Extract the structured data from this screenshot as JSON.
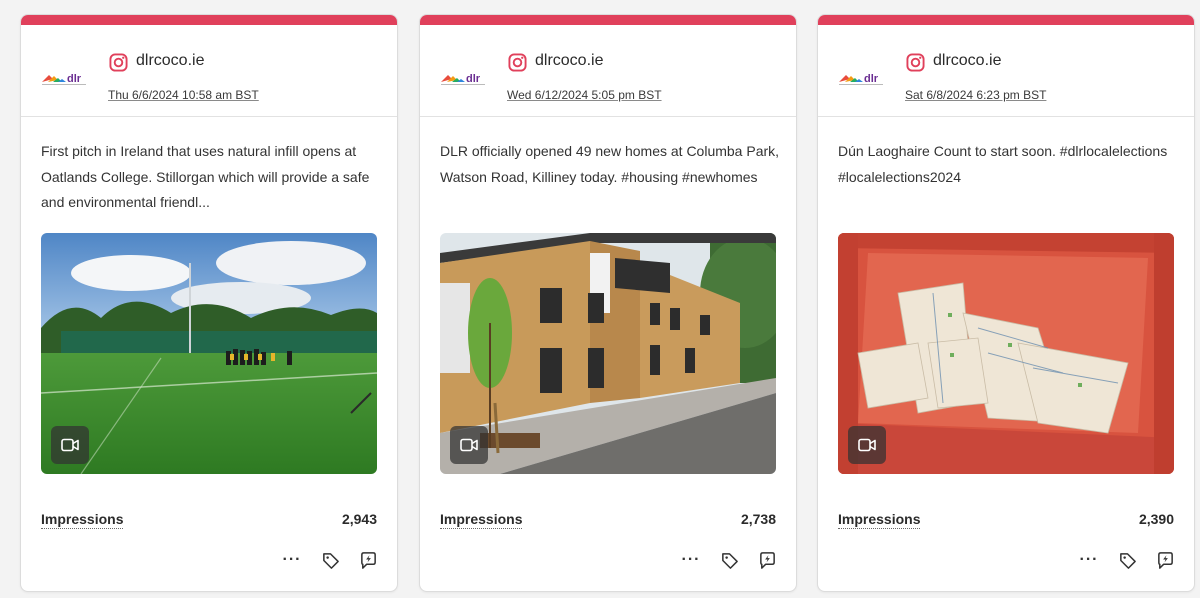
{
  "colors": {
    "card_accent": "#e0405b",
    "instagram": "#e0405b"
  },
  "icons": {
    "account": "instagram-icon",
    "media_type": "video-camera-icon",
    "more": "more-horizontal-icon",
    "tag": "tag-icon",
    "boost": "boost-post-icon"
  },
  "cards": [
    {
      "account": "dlrcoco.ie",
      "date": "Thu 6/6/2024 10:58 am BST",
      "caption": "First pitch in Ireland that uses natural infill opens at Oatlands College. Stillorgan which will provide a safe and environmental friendl...",
      "media_type": "video",
      "metric_label": "Impressions",
      "metric_value": "2,943",
      "more_label": "···"
    },
    {
      "account": "dlrcoco.ie",
      "date": "Wed 6/12/2024 5:05 pm BST",
      "caption": "DLR officially opened 49 new homes at Columba Park, Watson Road, Killiney today. #housing #newhomes",
      "media_type": "video",
      "metric_label": "Impressions",
      "metric_value": "2,738",
      "more_label": "···"
    },
    {
      "account": "dlrcoco.ie",
      "date": "Sat 6/8/2024 6:23 pm BST",
      "caption": "Dún Laoghaire Count to start soon. #dlrlocalelections #localelections2024",
      "media_type": "video",
      "metric_label": "Impressions",
      "metric_value": "2,390",
      "more_label": "···"
    }
  ]
}
